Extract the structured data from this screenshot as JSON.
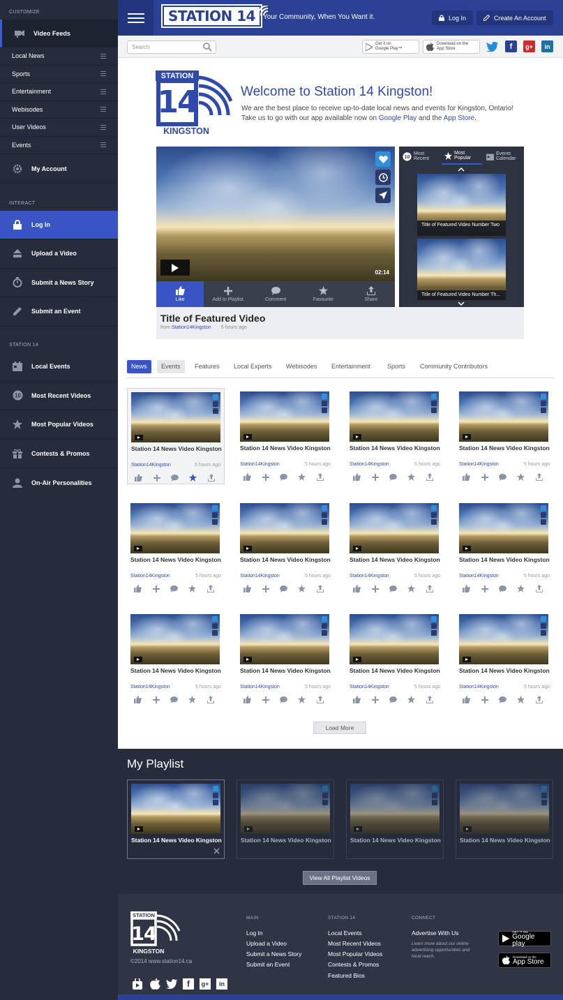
{
  "sidebar": {
    "customize_heading": "CUSTOMIZE",
    "video_feeds": "Video Feeds",
    "feeds": [
      "Local News",
      "Sports",
      "Entertainment",
      "Webisodes",
      "User Videos",
      "Events"
    ],
    "my_account": "My Account",
    "interact_heading": "INTERACT",
    "interact": [
      "Log In",
      "Upload a Video",
      "Submit a News Story",
      "Submit an Event"
    ],
    "station_heading": "STATION 14",
    "station": [
      "Local Events",
      "Most Recent Videos",
      "Most Popular Videos",
      "Contests & Promos",
      "On-Air Personalities"
    ]
  },
  "header": {
    "logo_text": "STATION 14",
    "tagline": "Your Community,  When You Want it.",
    "login": "Log In",
    "create_account": "Create An Account"
  },
  "toolbar": {
    "search_placeholder": "Search",
    "google_play_line1": "Get it on",
    "google_play_line2": "Google Play™",
    "app_store_line1": "Download on the",
    "app_store_line2": "App Store"
  },
  "welcome": {
    "logo_station": "STATION",
    "logo_number": "14",
    "logo_city": "KINGSTON",
    "title": "Welcome to Station 14 Kingston!",
    "text_1": "We are the best place to receive up-to-date local news and events for Kingston, Ontario!",
    "text_2": "Take us to go with our app available now on ",
    "link_google": "Google Play",
    "text_3": " and the ",
    "link_apple": "App Store",
    "text_4": "."
  },
  "featured": {
    "duration": "02:14",
    "actions": [
      "Like",
      "Add to Playlist",
      "Comment",
      "Favourite",
      "Share"
    ],
    "title": "Title of Featured Video",
    "from_label": "from ",
    "channel": "Station14Kingston",
    "age": "5 hours ago"
  },
  "side_panel": {
    "tab_recent_num": "10",
    "tab_recent_1": "Most",
    "tab_recent_2": "Recent",
    "tab_popular_1": "Most",
    "tab_popular_2": "Popular",
    "tab_events_1": "Events",
    "tab_events_2": "Calendar",
    "video_2": "Title of Featured Video Number Two",
    "video_3": "Title of Featured Video Number Th..."
  },
  "tabs": [
    "News",
    "Events",
    "Features",
    "Local Experts",
    "Webisodes",
    "Entertainment",
    "Sports",
    "Community Contributors"
  ],
  "card": {
    "title": "Station 14 News Video Kingston",
    "channel": "Station14Kingston",
    "age": "5 hours ago"
  },
  "load_more": "Load More",
  "playlist": {
    "title": "My Playlist",
    "card_title": "Station 14 News Video Kingston",
    "view_all": "View All Playlist Videos"
  },
  "footer": {
    "logo_station": "STATION",
    "logo_number": "14",
    "logo_city": "KINGSTON",
    "copyright": "©2014 www.station14.ca",
    "main_heading": "MAIN",
    "main_links": [
      "Log In",
      "Upload a Video",
      "Submit a News Story",
      "Submit an Event"
    ],
    "station_heading": "STATION 14",
    "station_links": [
      "Local Events",
      "Most Recent Videos",
      "Most Popular Videos",
      "Contests & Promos",
      "Featured Bios"
    ],
    "connect_heading": "CONNECT",
    "advertise": "Advertise With Us",
    "advertise_note": "Learn more about our online advertising opportunities and local reach.",
    "gp_1": "GET IT ON",
    "gp_2": "Google play",
    "as_1": "Download on the",
    "as_2": "App Store"
  },
  "colors": {
    "brand_blue": "#2b4196",
    "accent_blue": "#3955c5",
    "dark_bg": "#262c3b"
  }
}
